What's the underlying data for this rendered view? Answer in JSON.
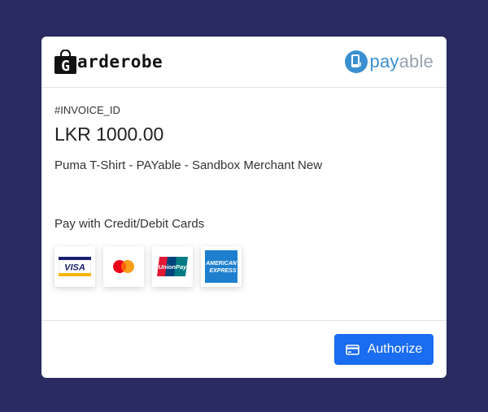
{
  "merchant": {
    "logo_letter": "G",
    "logo_text": "arderobe"
  },
  "provider": {
    "name_part1": "pay",
    "name_part2": "able",
    "brand_color": "#3a8fd0"
  },
  "invoice": {
    "id": "#INVOICE_ID",
    "amount": "LKR 1000.00",
    "description": "Puma T-Shirt - PAYable - Sandbox Merchant New"
  },
  "payment": {
    "method_label": "Pay with Credit/Debit Cards",
    "cards": [
      "visa-icon",
      "mastercard-icon",
      "unionpay-icon",
      "amex-icon"
    ],
    "visa_text": "VISA",
    "unionpay_text": "UnionPay",
    "amex_text_1": "AMERICAN",
    "amex_text_2": "EXPRESS"
  },
  "actions": {
    "authorize_label": "Authorize",
    "button_color": "#1a6cf0"
  },
  "colors": {
    "background": "#292a5f"
  }
}
